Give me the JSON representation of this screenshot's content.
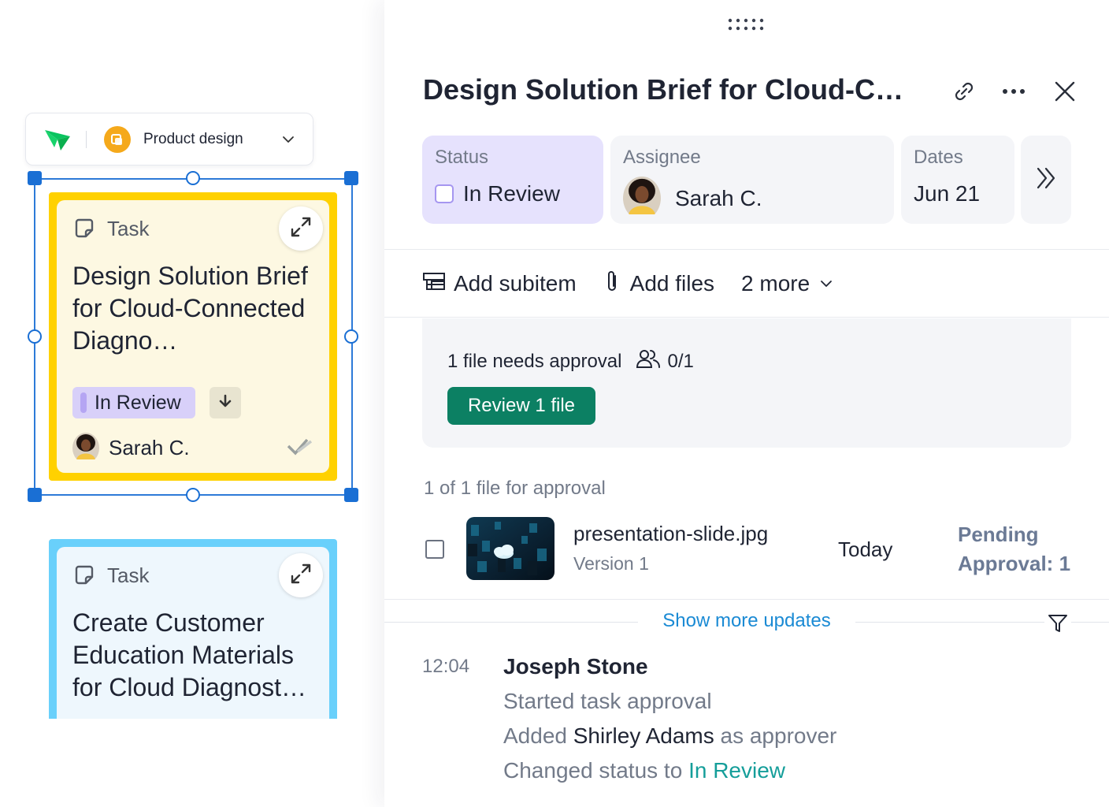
{
  "canvas": {
    "project_selector": {
      "name": "Product design"
    },
    "cards": [
      {
        "type_label": "Task",
        "title": "Design Solution Brief for Cloud-Connected Diagno…",
        "status": "In Review",
        "assignee": "Sarah C."
      },
      {
        "type_label": "Task",
        "title": "Create Customer Education Materials for Cloud Diagnost…"
      }
    ]
  },
  "panel": {
    "title": "Design Solution Brief for Cloud-C…",
    "fields": {
      "status": {
        "label": "Status",
        "value": "In Review"
      },
      "assignee": {
        "label": "Assignee",
        "value": "Sarah C."
      },
      "dates": {
        "label": "Dates",
        "value": "Jun 21"
      }
    },
    "actions": {
      "add_subitem": "Add subitem",
      "add_files": "Add files",
      "more": "2 more"
    },
    "approval": {
      "needs_text": "1 file needs approval",
      "approvers_count": "0/1",
      "review_button": "Review 1 file",
      "count_text": "1 of 1 file for approval"
    },
    "file": {
      "name": "presentation-slide.jpg",
      "version": "Version 1",
      "date": "Today",
      "status": "Pending Approval: 1"
    },
    "show_more": "Show more updates",
    "activity": {
      "time": "12:04",
      "author": "Joseph Stone",
      "line1": "Started task approval",
      "line2_prefix": "Added",
      "line2_name": "Shirley Adams",
      "line2_suffix": "as approver",
      "line3_prefix": "Changed status to",
      "line3_status": "In Review"
    }
  },
  "colors": {
    "selection_blue": "#1a6fd4",
    "card_yellow": "#ffd100",
    "card_blue": "#69d0fb",
    "status_purple": "#d8d0f9",
    "review_green": "#0c8063",
    "link_blue": "#1a8ad4",
    "teal_status": "#159e9a"
  },
  "icons": {
    "logo": "wrike-logo-icon",
    "project": "project-folder-icon",
    "task_type": "task-icon",
    "expand": "expand-icon",
    "priority": "arrow-down-icon",
    "complete": "double-check-icon",
    "link": "link-icon",
    "more": "more-horizontal-icon",
    "close": "close-icon",
    "expand_fields": "chevron-double-right-icon",
    "subitem": "subitem-icon",
    "attach": "paperclip-icon",
    "users": "users-icon",
    "filter": "filter-icon",
    "grip": "drag-grip-icon"
  }
}
